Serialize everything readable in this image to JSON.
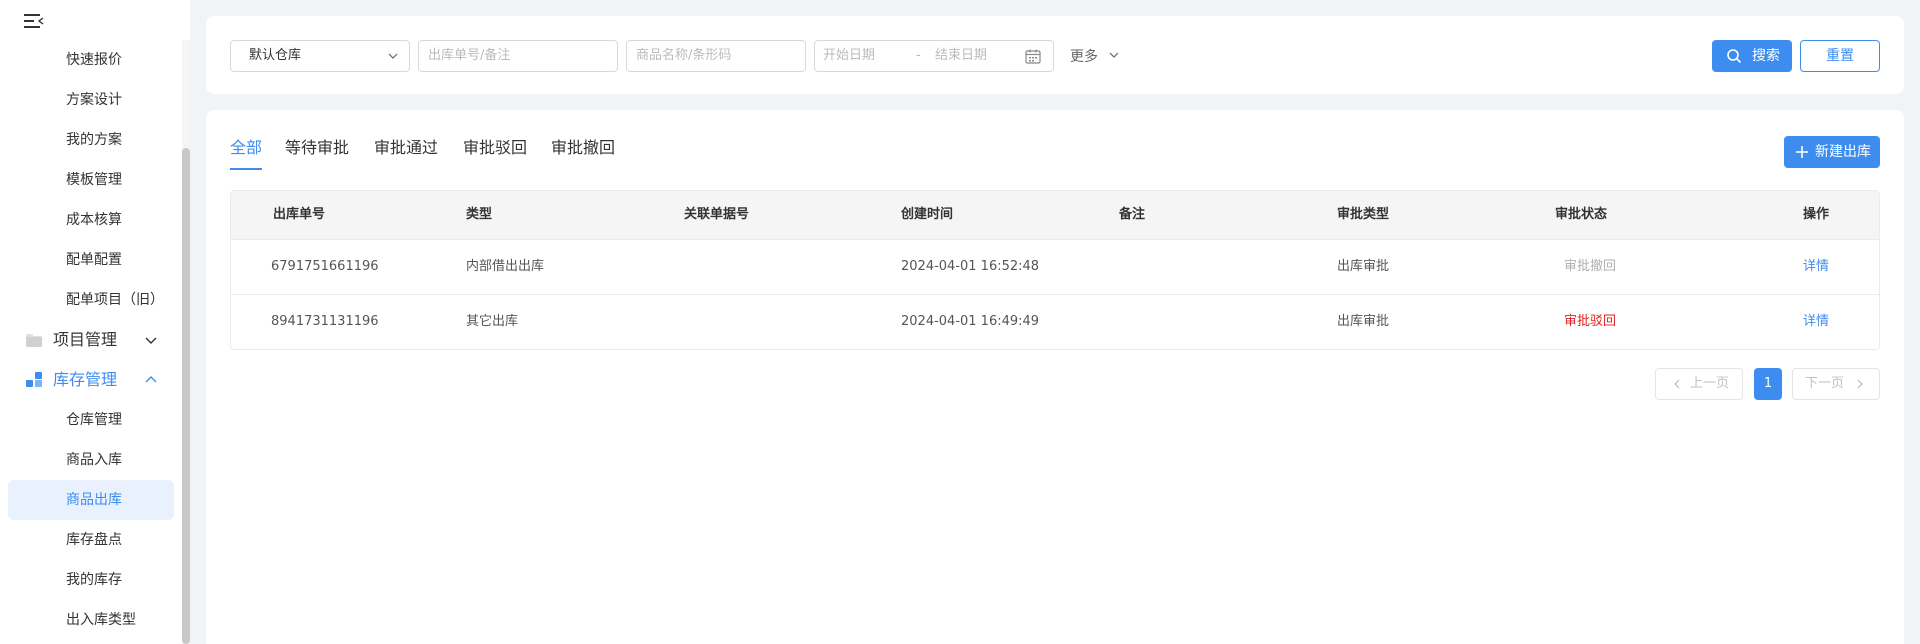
{
  "colors": {
    "accent": "#3d8cf0",
    "rejected": "#e02020",
    "withdrawn": "#b0b0b0"
  },
  "sidebar": {
    "items_top": [
      {
        "label": "快速报价"
      },
      {
        "label": "方案设计"
      },
      {
        "label": "我的方案"
      },
      {
        "label": "模板管理"
      },
      {
        "label": "成本核算"
      },
      {
        "label": "配单配置"
      },
      {
        "label": "配单项目（旧）"
      }
    ],
    "group_project": {
      "label": "项目管理",
      "icon": "folder-icon",
      "expanded": false
    },
    "group_inventory": {
      "label": "库存管理",
      "icon": "inventory-icon",
      "expanded": true
    },
    "items_inventory": [
      {
        "label": "仓库管理"
      },
      {
        "label": "商品入库"
      },
      {
        "label": "商品出库",
        "active": true
      },
      {
        "label": "库存盘点"
      },
      {
        "label": "我的库存"
      },
      {
        "label": "出入库类型"
      }
    ]
  },
  "filters": {
    "warehouse_value": "默认仓库",
    "order_placeholder": "出库单号/备注",
    "product_placeholder": "商品名称/条形码",
    "start_date_placeholder": "开始日期",
    "date_separator": "-",
    "end_date_placeholder": "结束日期",
    "more_label": "更多",
    "search_label": "搜索",
    "reset_label": "重置"
  },
  "tabs": [
    {
      "label": "全部",
      "active": true
    },
    {
      "label": "等待审批"
    },
    {
      "label": "审批通过"
    },
    {
      "label": "审批驳回"
    },
    {
      "label": "审批撤回"
    }
  ],
  "new_button_label": "新建出库",
  "table": {
    "columns": [
      "出库单号",
      "类型",
      "关联单据号",
      "创建时间",
      "备注",
      "审批类型",
      "审批状态",
      "操作"
    ],
    "rows": [
      {
        "order_no": "6791751661196",
        "type": "内部借出出库",
        "related_no": "",
        "created": "2024-04-01 16:52:48",
        "remark": "",
        "approval_type": "出库审批",
        "status": "审批撤回",
        "status_kind": "withdrawn",
        "action": "详情"
      },
      {
        "order_no": "8941731131196",
        "type": "其它出库",
        "related_no": "",
        "created": "2024-04-01 16:49:49",
        "remark": "",
        "approval_type": "出库审批",
        "status": "审批驳回",
        "status_kind": "rejected",
        "action": "详情"
      }
    ]
  },
  "pagination": {
    "prev_label": "上一页",
    "current_page": "1",
    "next_label": "下一页"
  }
}
